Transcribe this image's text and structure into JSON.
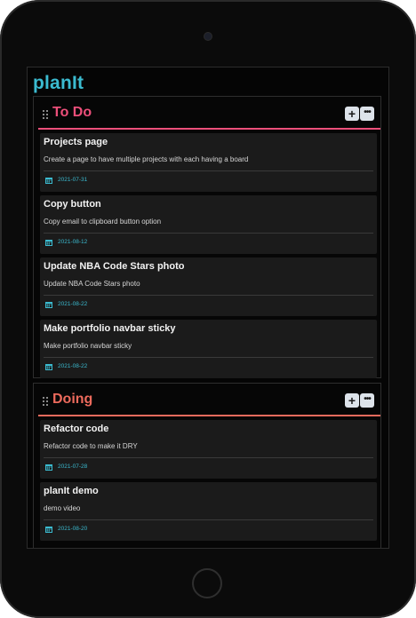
{
  "app": {
    "title": "planIt"
  },
  "colors": {
    "accent": "#3bbbd0",
    "todo": "#ec4f7a",
    "doing": "#ec6a5c",
    "card": "#1b1b1b"
  },
  "icons": {
    "drag": "drag-handle-icon",
    "add": "plus-icon",
    "more": "more-dots-icon",
    "date": "calendar-icon"
  },
  "columns": [
    {
      "title": "To Do",
      "add_label": "+",
      "more_label": "•••",
      "cards": [
        {
          "title": "Projects page",
          "description": "Create a page to have multiple projects with each having a board",
          "date": "2021-07-31"
        },
        {
          "title": "Copy button",
          "description": "Copy email to clipboard button option",
          "date": "2021-08-12"
        },
        {
          "title": "Update NBA Code Stars photo",
          "description": "Update NBA Code Stars photo",
          "date": "2021-08-22"
        },
        {
          "title": "Make portfolio navbar sticky",
          "description": "Make portfolio navbar sticky",
          "date": "2021-08-22"
        }
      ]
    },
    {
      "title": "Doing",
      "add_label": "+",
      "more_label": "•••",
      "cards": [
        {
          "title": "Refactor code",
          "description": "Refactor code to make it DRY",
          "date": "2021-07-28"
        },
        {
          "title": "planIt demo",
          "description": "demo video",
          "date": "2021-08-20"
        }
      ]
    }
  ]
}
